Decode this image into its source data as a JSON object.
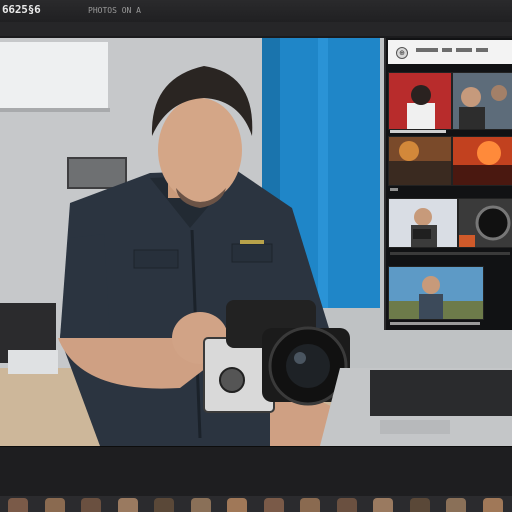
{
  "app": {
    "title": "6625§6",
    "subtitle": "PHOTOS ON A",
    "menu_hint": "…"
  },
  "colors": {
    "chrome": "#202022",
    "curtain": "#1f86c8",
    "shirt": "#2b3440",
    "wall": "#b9bcbe"
  },
  "laptop_page": {
    "logo_icon": "globe-icon",
    "thumbnails": [
      {
        "name": "man-speaking",
        "tone": "#b82c2c"
      },
      {
        "name": "crowd-scene",
        "tone": "#5d6c7a"
      },
      {
        "name": "fire-scene-1",
        "tone": "#7a4a2a"
      },
      {
        "name": "fire-scene-2",
        "tone": "#c2411f"
      },
      {
        "name": "photographer-portrait",
        "tone": "#d9dde4"
      },
      {
        "name": "camera-lens",
        "tone": "#3a3a3a"
      },
      {
        "name": "photographer-landscape",
        "tone": "#5d9ac6"
      }
    ]
  },
  "filmstrip": {
    "frame_count": 14
  }
}
